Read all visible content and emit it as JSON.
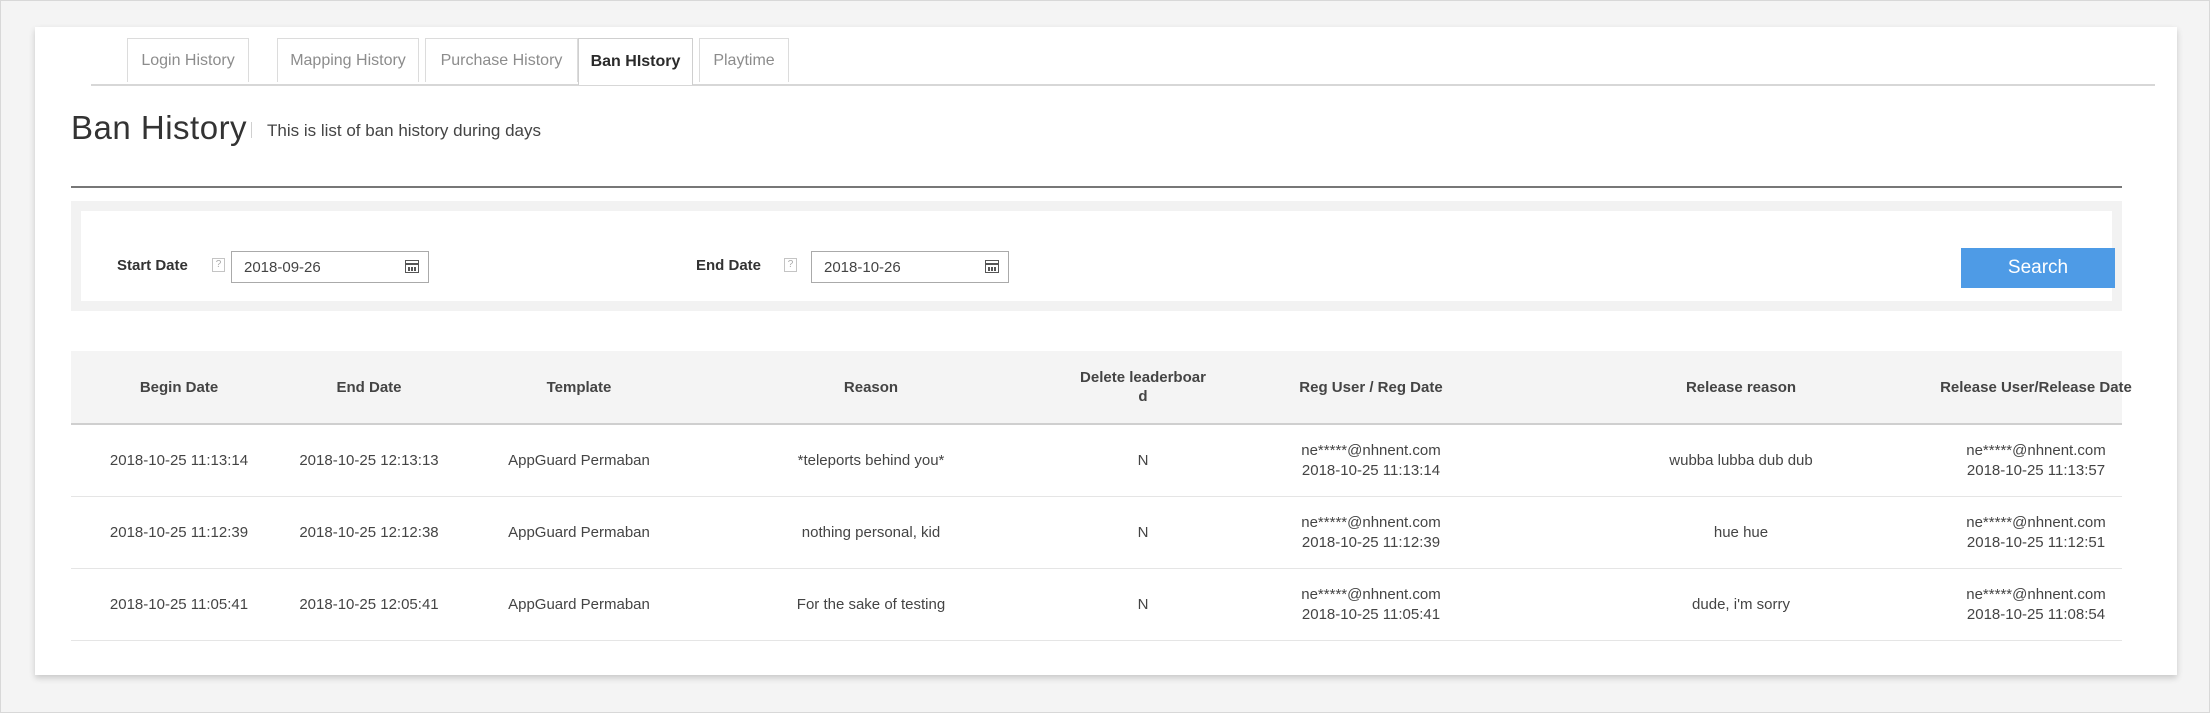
{
  "tabs": [
    {
      "label": "Login History",
      "active": false
    },
    {
      "label": "Mapping History",
      "active": false
    },
    {
      "label": "Purchase History",
      "active": false
    },
    {
      "label": "Ban HIstory",
      "active": true
    },
    {
      "label": "Playtime",
      "active": false
    }
  ],
  "header": {
    "title": "Ban History",
    "description": "This is list of ban history during days"
  },
  "filter": {
    "start_label": "Start Date",
    "start_value": "2018-09-26",
    "end_label": "End Date",
    "end_value": "2018-10-26",
    "help_glyph": "?",
    "search_label": "Search"
  },
  "table": {
    "columns": [
      "Begin Date",
      "End Date",
      "Template",
      "Reason",
      "Delete leaderboar\nd",
      "Reg User / Reg Date",
      "Release reason",
      "Release User/Release Date"
    ],
    "rows": [
      {
        "begin": "2018-10-25 11:13:14",
        "end": "2018-10-25 12:13:13",
        "template": "AppGuard Permaban",
        "reason": "*teleports behind you*",
        "delete_leaderboard": "N",
        "reg_user": "ne*****@nhnent.com",
        "reg_date": "2018-10-25 11:13:14",
        "release_reason": "wubba lubba dub dub",
        "release_user": "ne*****@nhnent.com",
        "release_date": "2018-10-25 11:13:57"
      },
      {
        "begin": "2018-10-25 11:12:39",
        "end": "2018-10-25 12:12:38",
        "template": "AppGuard Permaban",
        "reason": "nothing personal, kid",
        "delete_leaderboard": "N",
        "reg_user": "ne*****@nhnent.com",
        "reg_date": "2018-10-25 11:12:39",
        "release_reason": "hue hue",
        "release_user": "ne*****@nhnent.com",
        "release_date": "2018-10-25 11:12:51"
      },
      {
        "begin": "2018-10-25 11:05:41",
        "end": "2018-10-25 12:05:41",
        "template": "AppGuard Permaban",
        "reason": "For the sake of testing",
        "delete_leaderboard": "N",
        "reg_user": "ne*****@nhnent.com",
        "reg_date": "2018-10-25 11:05:41",
        "release_reason": "dude, i'm sorry",
        "release_user": "ne*****@nhnent.com",
        "release_date": "2018-10-25 11:08:54"
      }
    ]
  },
  "icons": {
    "calendar": "calendar-icon",
    "help": "help-icon"
  },
  "colors": {
    "accent": "#4e9be6"
  }
}
